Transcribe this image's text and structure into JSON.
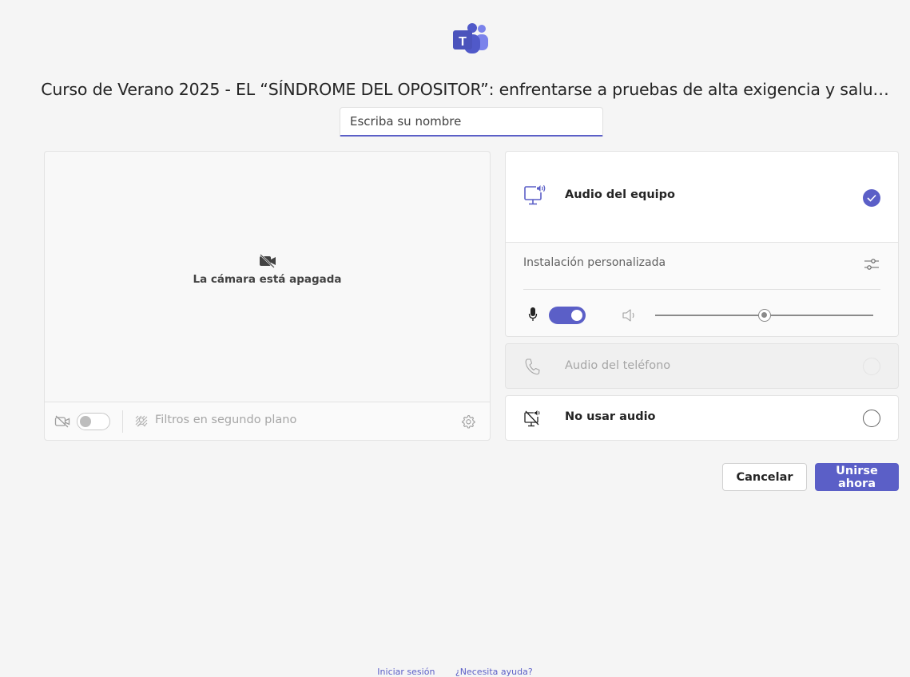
{
  "app": {
    "logo_icon": "teams-logo-icon",
    "meeting_title": "Curso de Verano 2025 - EL “SÍNDROME DEL OPOSITOR”: enfrentarse a pruebas de alta exigencia y salu…"
  },
  "name_field": {
    "placeholder": "Escriba su nombre",
    "value": ""
  },
  "video": {
    "camera_off_icon": "video-off-icon",
    "camera_off_label": "La cámara está apagada",
    "camera_toggle_on": false,
    "background_filters_label": "Filtros en segundo plano",
    "settings_icon": "gear-icon"
  },
  "audio": {
    "computer_audio": {
      "label": "Audio del equipo",
      "icon": "computer-speaker-icon",
      "selected": true
    },
    "custom_setup": {
      "label": "Instalación personalizada",
      "icon": "sliders-icon",
      "mic_on": true,
      "speaker_volume": 0.5
    },
    "phone_audio": {
      "label": "Audio del teléfono",
      "icon": "phone-icon",
      "selected": false,
      "disabled": true
    },
    "no_audio": {
      "label": "No usar audio",
      "icon": "speaker-off-icon",
      "selected": false
    }
  },
  "actions": {
    "cancel_label": "Cancelar",
    "join_label": "Unirse ahora"
  },
  "footer": {
    "sign_in": "Iniciar sesión",
    "help": "¿Necesita ayuda?"
  },
  "colors": {
    "accent": "#5b5fc7",
    "background": "#f5f5f5"
  }
}
